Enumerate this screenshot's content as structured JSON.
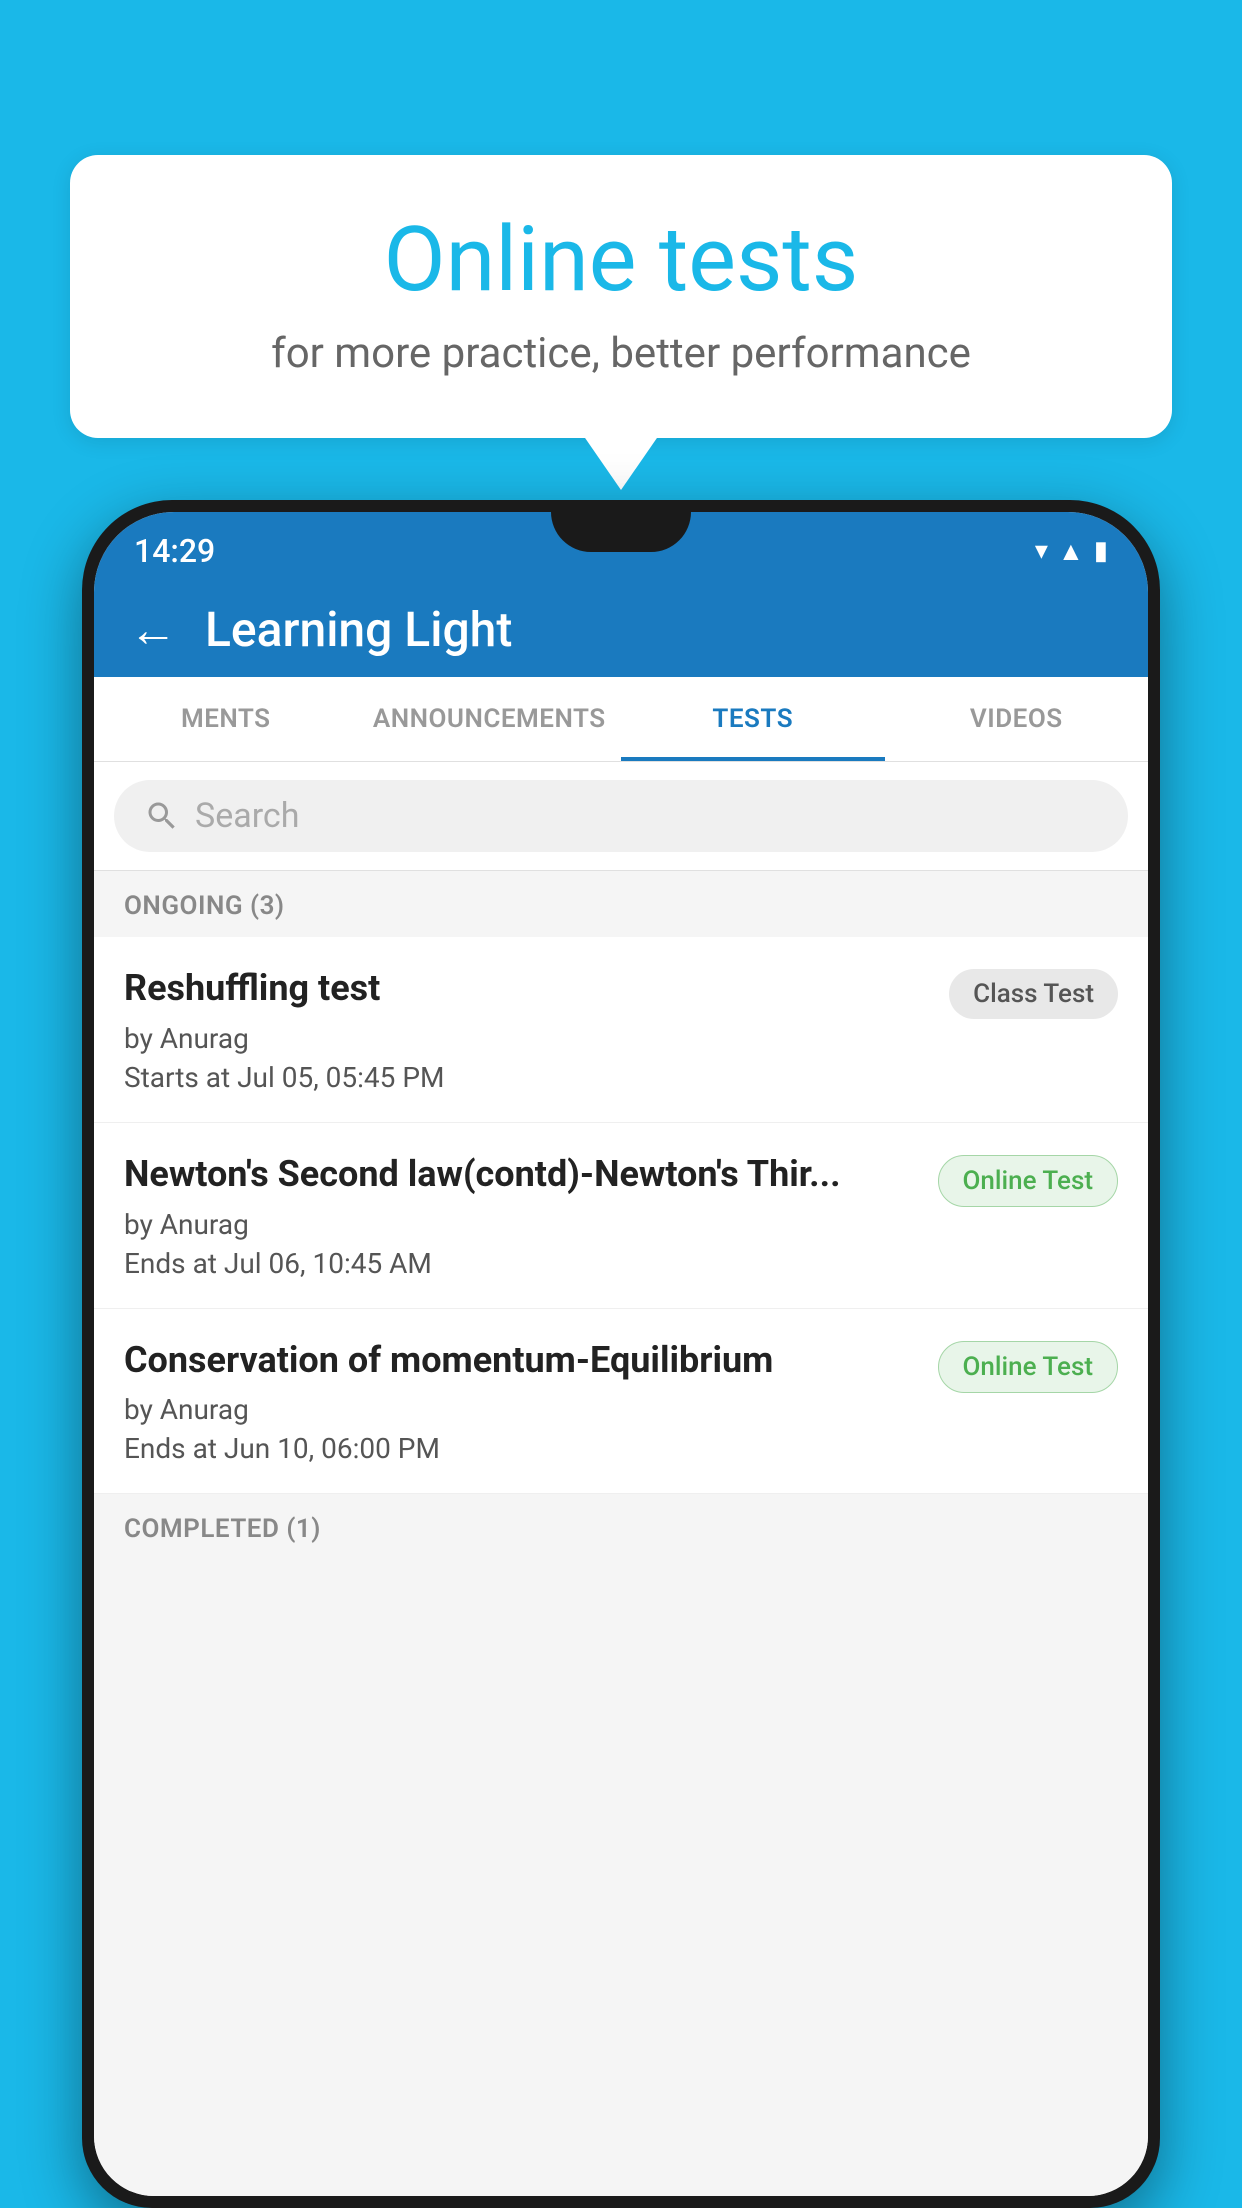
{
  "background_color": "#1ab8e8",
  "speech_bubble": {
    "title": "Online tests",
    "subtitle": "for more practice, better performance"
  },
  "status_bar": {
    "time": "14:29",
    "icons": [
      "wifi",
      "signal",
      "battery"
    ]
  },
  "app_bar": {
    "title": "Learning Light",
    "back_label": "←"
  },
  "tabs": [
    {
      "label": "MENTS",
      "active": false
    },
    {
      "label": "ANNOUNCEMENTS",
      "active": false
    },
    {
      "label": "TESTS",
      "active": true
    },
    {
      "label": "VIDEOS",
      "active": false
    }
  ],
  "search": {
    "placeholder": "Search"
  },
  "ongoing_section": {
    "label": "ONGOING (3)"
  },
  "test_items": [
    {
      "name": "Reshuffling test",
      "author": "by Anurag",
      "date": "Starts at  Jul 05, 05:45 PM",
      "badge": "Class Test",
      "badge_type": "class"
    },
    {
      "name": "Newton's Second law(contd)-Newton's Thir...",
      "author": "by Anurag",
      "date": "Ends at  Jul 06, 10:45 AM",
      "badge": "Online Test",
      "badge_type": "online"
    },
    {
      "name": "Conservation of momentum-Equilibrium",
      "author": "by Anurag",
      "date": "Ends at  Jun 10, 06:00 PM",
      "badge": "Online Test",
      "badge_type": "online"
    }
  ],
  "completed_section": {
    "label": "COMPLETED (1)"
  }
}
